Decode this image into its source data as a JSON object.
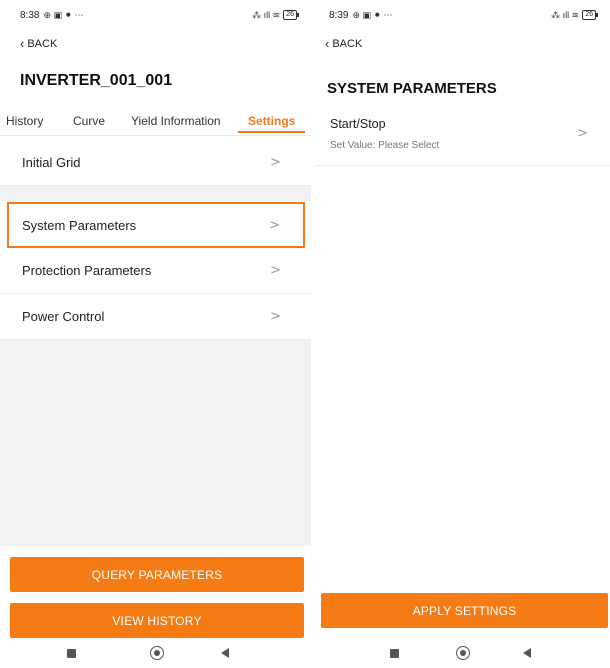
{
  "left": {
    "status": {
      "time": "8:38",
      "glyphs": "⊕ ▣ ⚫ ⋯",
      "signal": "⁂ ıll ≋",
      "battery": "26"
    },
    "back_label": "BACK",
    "title": "INVERTER_001_001",
    "tabs": [
      {
        "label": "History"
      },
      {
        "label": "Curve"
      },
      {
        "label": "Yield Information"
      },
      {
        "label": "Settings"
      }
    ],
    "menu": [
      {
        "label": "Initial Grid"
      },
      {
        "label": "System Parameters"
      },
      {
        "label": "Protection Parameters"
      },
      {
        "label": "Power Control"
      }
    ],
    "buttons": {
      "query": "QUERY PARAMETERS",
      "history": "VIEW HISTORY"
    }
  },
  "right": {
    "status": {
      "time": "8:39",
      "glyphs": "⊕ ▣ ⚫ ⋯",
      "signal": "⁂ ıll ≋",
      "battery": "26"
    },
    "back_label": "BACK",
    "title": "SYSTEM PARAMETERS",
    "param": {
      "name": "Start/Stop",
      "value": "Set Value: Please Select"
    },
    "buttons": {
      "apply": "APPLY SETTINGS"
    }
  },
  "theme": {
    "accent": "#f57c14",
    "separator": "#ececec",
    "band": "#f2f2f2"
  },
  "icons": {
    "back": "chevron-left-icon",
    "row": "chevron-right-icon",
    "nav": [
      "recents-square-icon",
      "home-circle-icon",
      "back-triangle-icon"
    ]
  }
}
